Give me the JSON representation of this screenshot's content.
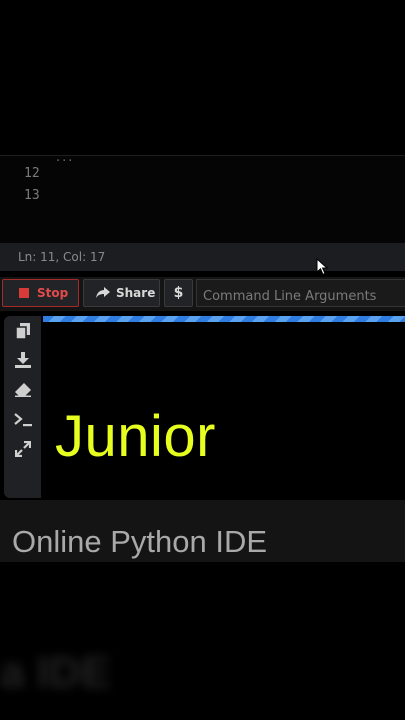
{
  "editor": {
    "line_numbers": [
      "12",
      "13"
    ],
    "partial_code": "..."
  },
  "status": {
    "position": "Ln: 11,  Col: 17"
  },
  "toolbar": {
    "stop_label": "Stop",
    "share_label": "Share",
    "dollar_label": "$",
    "args_placeholder": "Command Line Arguments"
  },
  "output": {
    "text": "Junior"
  },
  "footer": {
    "title": "Online Python IDE"
  },
  "background": {
    "blurred_text": "a IDE"
  },
  "colors": {
    "accent_yellow": "#e6ff1f",
    "stop_red": "#d93a3a",
    "progress_blue": "#2f7de0"
  }
}
